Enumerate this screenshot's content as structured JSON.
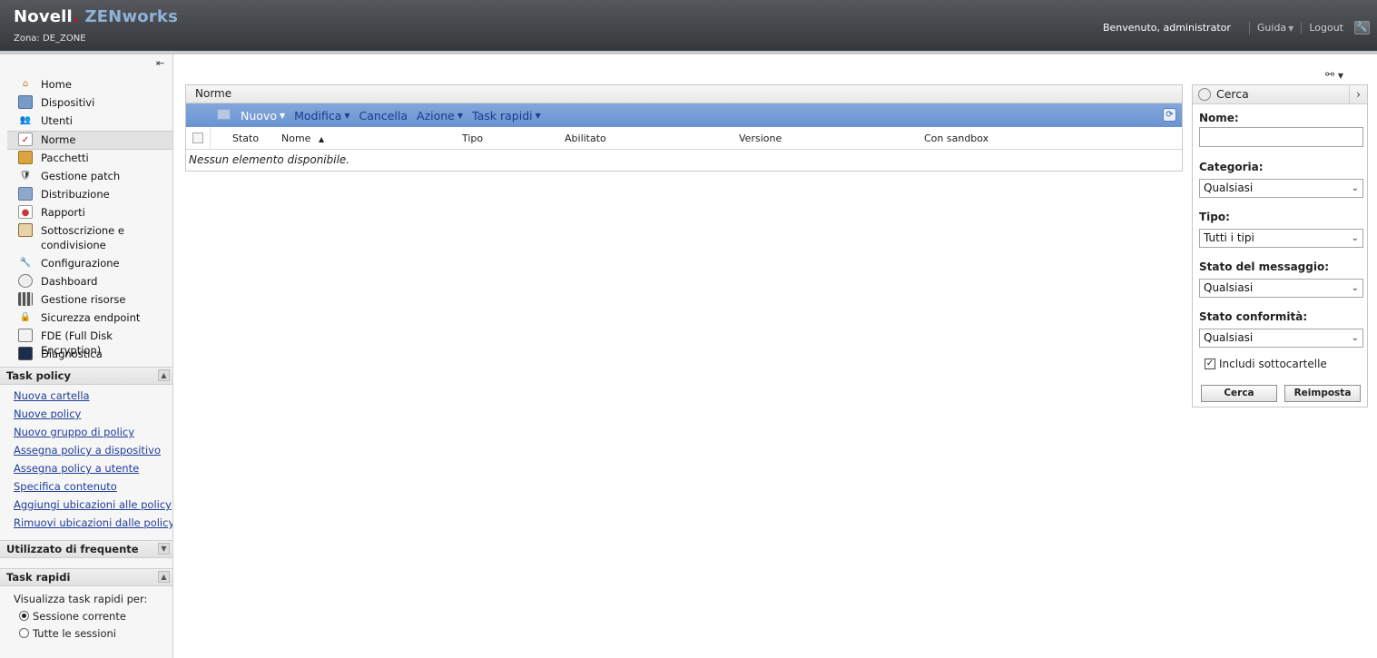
{
  "header": {
    "brand_novell": "Novell",
    "brand_dot": ".",
    "brand_zen": "ZENworks",
    "zone": "Zona: DE_ZONE",
    "welcome": "Benvenuto, administrator",
    "help": "Guida",
    "logout": "Logout"
  },
  "sidebar": {
    "items": [
      {
        "label": "Home"
      },
      {
        "label": "Dispositivi"
      },
      {
        "label": "Utenti"
      },
      {
        "label": "Norme"
      },
      {
        "label": "Pacchetti"
      },
      {
        "label": "Gestione patch"
      },
      {
        "label": "Distribuzione"
      },
      {
        "label": "Rapporti"
      },
      {
        "label": "Sottoscrizione e condivisione"
      },
      {
        "label": "Configurazione"
      },
      {
        "label": "Dashboard"
      },
      {
        "label": "Gestione risorse"
      },
      {
        "label": "Sicurezza endpoint"
      },
      {
        "label": "FDE (Full Disk Encryption)"
      },
      {
        "label": "Diagnostica"
      }
    ],
    "task_policy": {
      "title": "Task policy",
      "links": [
        "Nuova cartella",
        "Nuove policy",
        "Nuovo gruppo di policy",
        "Assegna policy a dispositivo",
        "Assegna policy a utente",
        "Specifica contenuto",
        "Aggiungi ubicazioni alle policy",
        "Rimuovi ubicazioni dalle policy"
      ]
    },
    "frequent": {
      "title": "Utilizzato di frequente"
    },
    "quick_tasks": {
      "title": "Task rapidi",
      "prompt": "Visualizza task rapidi per:",
      "option_current": "Sessione corrente",
      "option_all": "Tutte le sessioni",
      "selected": "Sessione corrente"
    }
  },
  "main": {
    "grid_title": "Norme",
    "toolbar": {
      "new": "Nuovo",
      "edit": "Modifica",
      "delete": "Cancella",
      "action": "Azione",
      "quick_tasks": "Task rapidi"
    },
    "columns": [
      "Stato",
      "Nome",
      "Tipo",
      "Abilitato",
      "Versione",
      "Con sandbox"
    ],
    "sort_column": "Nome",
    "empty_message": "Nessun elemento disponibile."
  },
  "search": {
    "title": "Cerca",
    "name_label": "Nome:",
    "name_value": "",
    "category_label": "Categoria:",
    "category_value": "Qualsiasi",
    "type_label": "Tipo:",
    "type_value": "Tutti i tipi",
    "message_state_label": "Stato del messaggio:",
    "message_state_value": "Qualsiasi",
    "compliance_label": "Stato conformità:",
    "compliance_value": "Qualsiasi",
    "include_subfolders": "Includi sottocartelle",
    "include_subfolders_checked": true,
    "search_button": "Cerca",
    "reset_button": "Reimposta"
  },
  "colors": {
    "header_dark": "#35383b",
    "toolbar_blue": "#6a93d1",
    "link_blue": "#1f3d99",
    "brand_red": "#c8102e"
  }
}
